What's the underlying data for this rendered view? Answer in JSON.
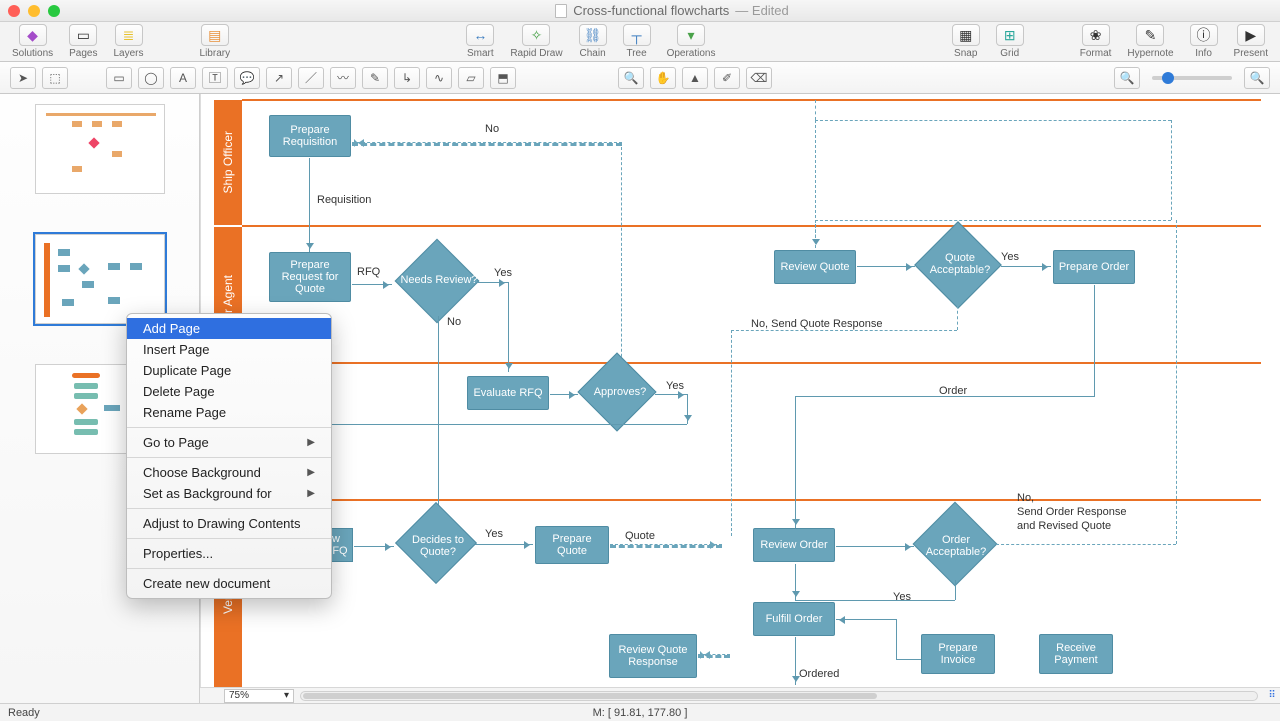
{
  "window": {
    "title": "Cross-functional flowcharts",
    "edited": "— Edited"
  },
  "toolbar": {
    "left": [
      "Solutions",
      "Pages",
      "Layers"
    ],
    "library": "Library",
    "mid": [
      "Smart",
      "Rapid Draw",
      "Chain",
      "Tree",
      "Operations"
    ],
    "right1": [
      "Snap",
      "Grid"
    ],
    "right2": [
      "Format",
      "Hypernote",
      "Info",
      "Present"
    ]
  },
  "context_menu": {
    "items": [
      {
        "label": "Add Page",
        "selected": true
      },
      {
        "label": "Insert Page"
      },
      {
        "label": "Duplicate Page"
      },
      {
        "label": "Delete Page"
      },
      {
        "label": "Rename Page"
      },
      {
        "sep": true
      },
      {
        "label": "Go to Page",
        "sub": true
      },
      {
        "sep": true
      },
      {
        "label": "Choose Background",
        "sub": true
      },
      {
        "label": "Set as Background for",
        "sub": true
      },
      {
        "sep": true
      },
      {
        "label": "Adjust to Drawing Contents"
      },
      {
        "sep": true
      },
      {
        "label": "Properties..."
      },
      {
        "sep": true
      },
      {
        "label": "Create new document"
      }
    ]
  },
  "lanes": {
    "l1": "Ship Officer",
    "l2": "r Agent",
    "l3": "",
    "l4": "Vendor"
  },
  "nodes": {
    "prep_req": "Prepare Requisition",
    "prep_rfq": "Prepare Request for Quote",
    "needs_review": "Needs Review?",
    "review_quote": "Review Quote",
    "quote_acc": "Quote Acceptable?",
    "prep_order": "Prepare Order",
    "eval_rfq": "Evaluate RFQ",
    "approves": "Approves?",
    "w_rfq": "w RFQ",
    "dec_quote": "Decides to Quote?",
    "prep_quote": "Prepare Quote",
    "review_order": "Review Order",
    "order_acc": "Order Acceptable?",
    "fulfill": "Fulfill Order",
    "prep_inv": "Prepare Invoice",
    "recv_pay": "Receive Payment",
    "rq_resp": "Review Quote Response"
  },
  "labels": {
    "no": "No",
    "yes": "Yes",
    "requisition": "Requisition",
    "rfq": "RFQ",
    "no_send_quote": "No, Send Quote Response",
    "order": "Order",
    "quote": "Quote",
    "no_send_order": "No,\nSend Order Response\nand Revised Quote",
    "ordered": "Ordered"
  },
  "footer": {
    "zoom": "75%"
  },
  "status": {
    "ready": "Ready",
    "mouse": "M: [ 91.81, 177.80 ]"
  }
}
